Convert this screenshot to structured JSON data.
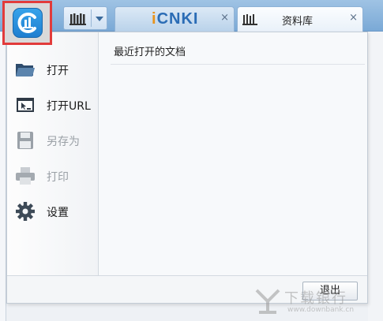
{
  "app": {
    "logo_icon": "app-logo-icon"
  },
  "toolbar": {
    "library_icon": "library-icon",
    "dropdown_icon": "chevron-down-icon"
  },
  "tabs": [
    {
      "logo_first": "i",
      "logo_rest": "CNKI",
      "close": "×"
    },
    {
      "icon": "library-icon",
      "label": "资料库",
      "close": "×"
    }
  ],
  "menu": {
    "items": [
      {
        "label": "打开",
        "icon": "folder-open-icon",
        "enabled": true
      },
      {
        "label": "打开URL",
        "icon": "url-window-icon",
        "enabled": true
      },
      {
        "label": "另存为",
        "icon": "save-disk-icon",
        "enabled": false
      },
      {
        "label": "打印",
        "icon": "printer-icon",
        "enabled": false
      },
      {
        "label": "设置",
        "icon": "gear-icon",
        "enabled": true
      }
    ]
  },
  "recent": {
    "title": "最近打开的文档"
  },
  "footer": {
    "exit_label": "退出"
  },
  "watermark": {
    "text": "下载银行",
    "url": "www.downbank.cn"
  },
  "colors": {
    "accent": "#2a86d9",
    "highlight_border": "#e23b3b"
  }
}
